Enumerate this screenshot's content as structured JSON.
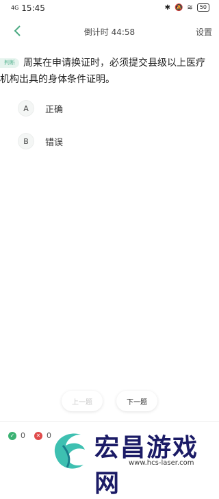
{
  "status_bar": {
    "signal": "4G",
    "time": "15:45",
    "icons": [
      "bluetooth-icon",
      "silent-icon",
      "wifi-icon",
      "battery-icon"
    ],
    "battery": "50"
  },
  "header": {
    "timer": "倒计时 44:58",
    "settings_label": "设置"
  },
  "question": {
    "tag": "判断",
    "text": "周某在申请换证时，必须提交县级以上医疗机构出具的身体条件证明。"
  },
  "options": [
    {
      "letter": "A",
      "label": "正确"
    },
    {
      "letter": "B",
      "label": "错误"
    }
  ],
  "navigation": {
    "prev_label": "上一题",
    "next_label": "下一题"
  },
  "stats": {
    "correct_count": "0",
    "wrong_count": "0"
  },
  "watermark": {
    "title": "宏昌游戏网",
    "url": "www.hcs-laser.com"
  },
  "colors": {
    "accent": "#5ab593",
    "correct": "#3bb273",
    "wrong": "#e04b4b"
  }
}
